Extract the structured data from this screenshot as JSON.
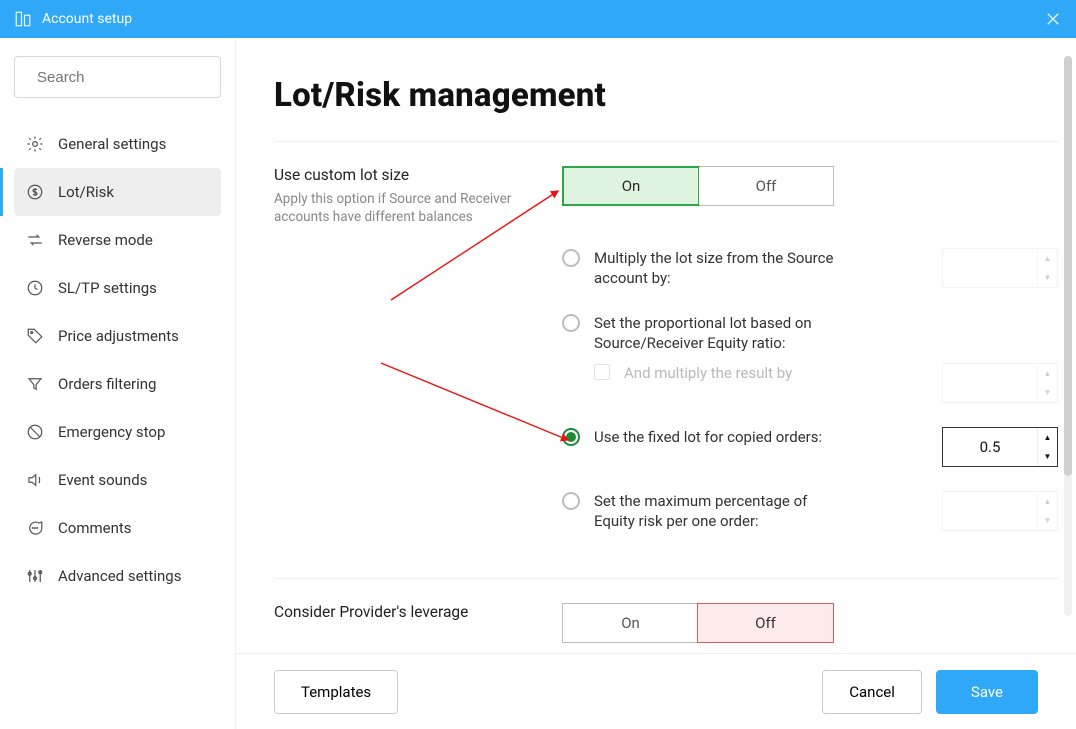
{
  "titlebar": {
    "title": "Account setup"
  },
  "search": {
    "placeholder": "Search"
  },
  "sidebar": {
    "items": [
      {
        "label": "General settings"
      },
      {
        "label": "Lot/Risk"
      },
      {
        "label": "Reverse mode"
      },
      {
        "label": "SL/TP settings"
      },
      {
        "label": "Price adjustments"
      },
      {
        "label": "Orders filtering"
      },
      {
        "label": "Emergency stop"
      },
      {
        "label": "Event sounds"
      },
      {
        "label": "Comments"
      },
      {
        "label": "Advanced settings"
      }
    ]
  },
  "main": {
    "title": "Lot/Risk management",
    "toggle": {
      "on": "On",
      "off": "Off"
    },
    "custom_lot": {
      "label": "Use custom lot size",
      "sub": "Apply this option if Source and Receiver accounts have different balances",
      "state": "On"
    },
    "options": {
      "multiply": "Multiply the lot size from the Source account by:",
      "proportional": "Set the proportional lot based on Source/Receiver Equity ratio:",
      "proportional_sub": "And multiply the result by",
      "fixed": "Use the fixed lot for copied orders:",
      "fixed_value": "0.5",
      "max_equity": "Set the maximum percentage of Equity risk per one order:"
    },
    "leverage": {
      "label": "Consider Provider's leverage",
      "state": "Off"
    }
  },
  "footer": {
    "templates": "Templates",
    "cancel": "Cancel",
    "save": "Save"
  }
}
